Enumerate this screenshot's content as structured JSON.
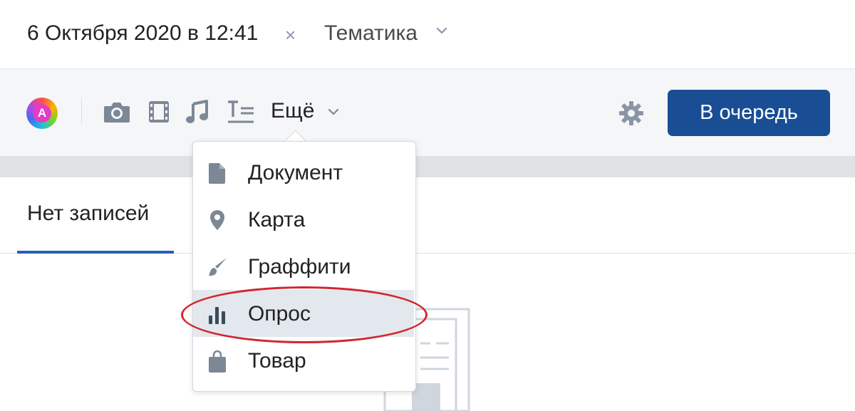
{
  "header": {
    "date": "6 Октября 2020 в 12:41",
    "date_close": "×",
    "topic": "Тематика"
  },
  "toolbar": {
    "avatar_letter": "A",
    "icons": [
      "camera-icon",
      "film-icon",
      "music-icon",
      "text-format-icon"
    ],
    "more_label": "Ещё",
    "queue_label": "В очередь"
  },
  "tabs": {
    "active": "Нет записей"
  },
  "dropdown": {
    "items": [
      {
        "label": "Документ",
        "icon": "document-icon"
      },
      {
        "label": "Карта",
        "icon": "map-pin-icon"
      },
      {
        "label": "Граффити",
        "icon": "brush-icon"
      },
      {
        "label": "Опрос",
        "icon": "poll-icon",
        "highlighted": true
      },
      {
        "label": "Товар",
        "icon": "shopping-bag-icon"
      }
    ]
  },
  "colors": {
    "primary_button": "#194e94",
    "tab_underline": "#2b5fad",
    "icon_gray": "#7c8896",
    "highlight_bg": "#e3e8ee",
    "annotation_red": "#d2262d"
  }
}
